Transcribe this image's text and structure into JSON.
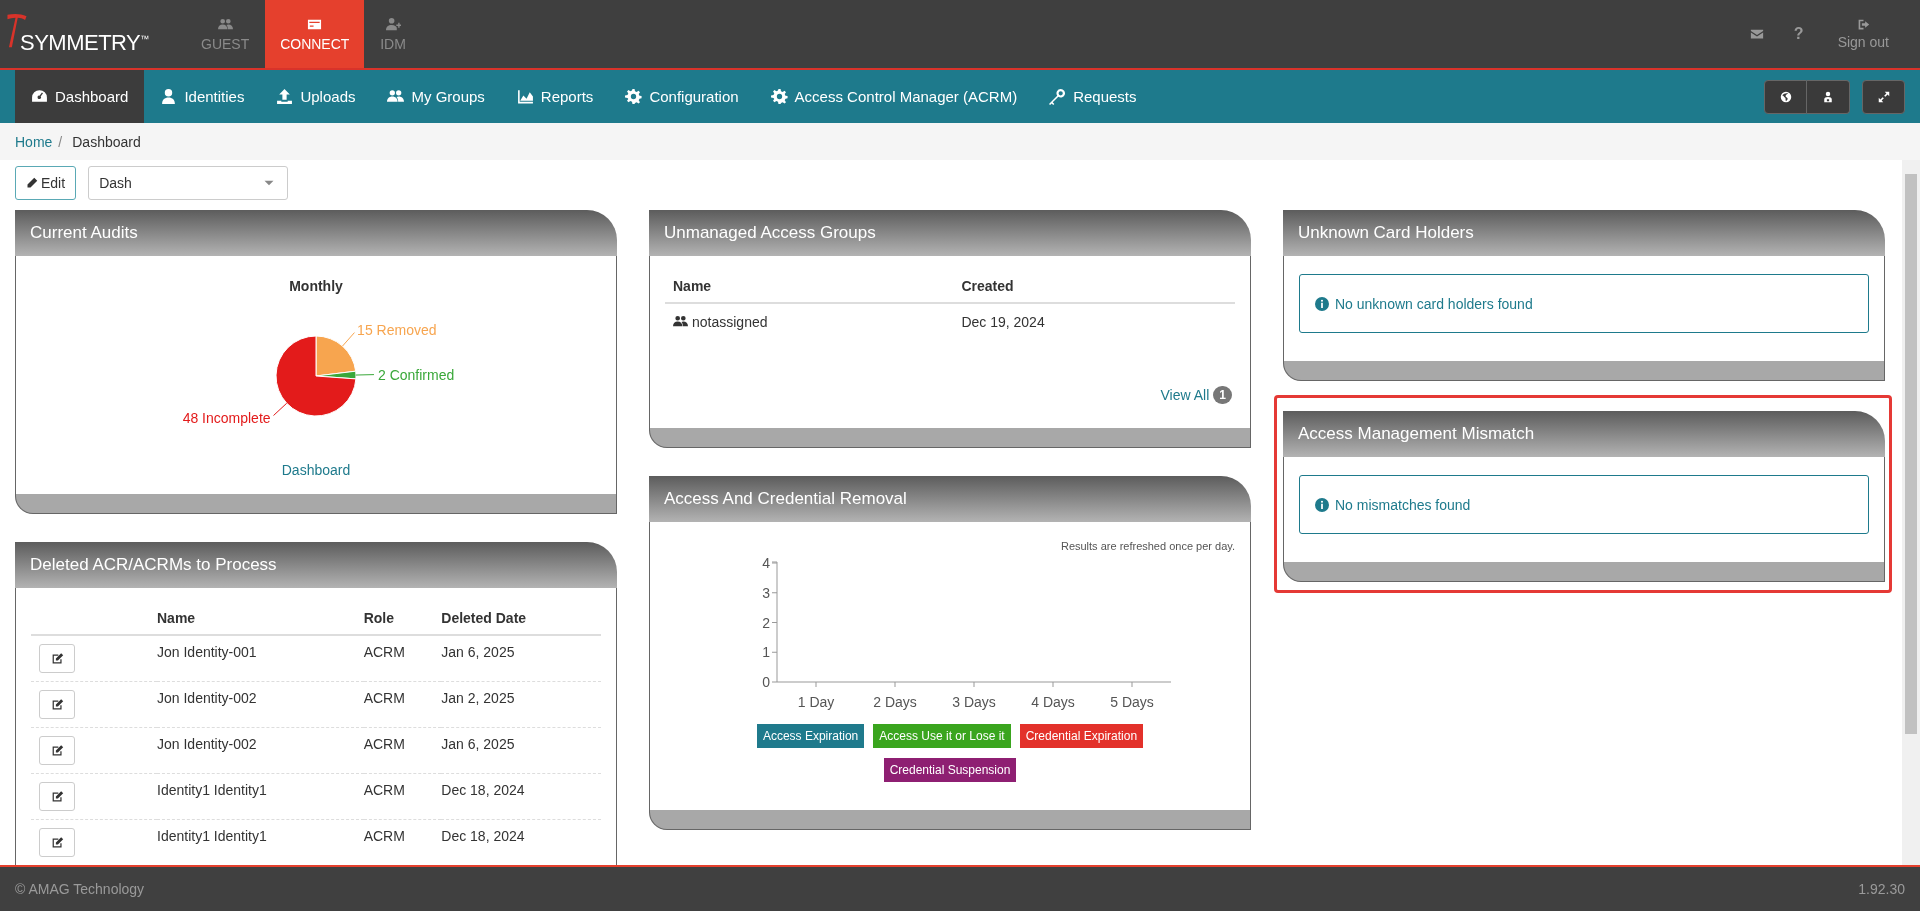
{
  "topbar": {
    "logo": {
      "text": "SYMMETRY",
      "mark": "™"
    },
    "apps": [
      {
        "label": "GUEST",
        "selected": false
      },
      {
        "label": "CONNECT",
        "selected": true
      },
      {
        "label": "IDM",
        "selected": false
      }
    ],
    "help": "?",
    "sign_out": "Sign out"
  },
  "nav": {
    "items": [
      {
        "label": "Dashboard",
        "selected": true
      },
      {
        "label": "Identities",
        "selected": false
      },
      {
        "label": "Uploads",
        "selected": false
      },
      {
        "label": "My Groups",
        "selected": false
      },
      {
        "label": "Reports",
        "selected": false
      },
      {
        "label": "Configuration",
        "selected": false
      },
      {
        "label": "Access Control Manager (ACRM)",
        "selected": false
      },
      {
        "label": "Requests",
        "selected": false
      }
    ]
  },
  "breadcrumb": {
    "items": [
      "Home",
      "Dashboard"
    ],
    "separator": "/"
  },
  "toolbar": {
    "edit": "Edit",
    "dashboard_select": {
      "value": "Dash"
    }
  },
  "columns": [
    {
      "panels": [
        {
          "kind": "pie",
          "title": "Current Audits",
          "highlighted": false,
          "link": "Dashboard",
          "chart_data": {
            "type": "pie",
            "title": "Monthly",
            "categories": [
              "15 Removed",
              "2 Confirmed",
              "48 Incomplete"
            ],
            "series": [
              {
                "values": [
                  15,
                  2,
                  48
                ],
                "colors": [
                  "#f7a54f",
                  "#3aa83a",
                  "#e31b1b"
                ]
              }
            ]
          }
        },
        {
          "kind": "table",
          "title": "Deleted ACR/ACRMs to Process",
          "highlighted": false,
          "columns": [
            "Name",
            "Role",
            "Deleted Date"
          ],
          "rows": [
            [
              "Jon Identity-001",
              "ACRM",
              "Jan 6, 2025"
            ],
            [
              "Jon Identity-002",
              "ACRM",
              "Jan 2, 2025"
            ],
            [
              "Jon Identity-002",
              "ACRM",
              "Jan 6, 2025"
            ],
            [
              "Identity1 Identity1",
              "ACRM",
              "Dec 18, 2024"
            ],
            [
              "Identity1 Identity1",
              "ACRM",
              "Dec 18, 2024"
            ]
          ]
        }
      ]
    },
    {
      "panels": [
        {
          "kind": "groups",
          "title": "Unmanaged Access Groups",
          "highlighted": false,
          "columns": [
            "Name",
            "Created"
          ],
          "rows": [
            [
              "notassigned",
              "Dec 19, 2024"
            ]
          ],
          "view_all": "View All",
          "count": "1"
        },
        {
          "kind": "bar",
          "title": "Access And Credential Removal",
          "highlighted": false,
          "note": "Results are refreshed once per day.",
          "chart_data": {
            "type": "bar",
            "categories": [
              "1 Day",
              "2 Days",
              "3 Days",
              "4 Days",
              "5 Days"
            ],
            "ylim": [
              0,
              4
            ],
            "yticks": [
              0,
              1,
              2,
              3,
              4
            ],
            "series": [
              {
                "name": "Access Expiration",
                "color": "#1f7a8c",
                "values": [
                  0,
                  0,
                  0,
                  0,
                  0
                ]
              },
              {
                "name": "Access Use it or Lose it",
                "color": "#3aa51e",
                "values": [
                  0,
                  0,
                  0,
                  0,
                  0
                ]
              },
              {
                "name": "Credential Expiration",
                "color": "#e3312a",
                "values": [
                  0,
                  0,
                  0,
                  0,
                  0
                ]
              },
              {
                "name": "Credential Suspension",
                "color": "#8e1f72",
                "values": [
                  0,
                  0,
                  0,
                  0,
                  0
                ]
              }
            ]
          }
        }
      ]
    },
    {
      "panels": [
        {
          "kind": "info",
          "title": "Unknown Card Holders",
          "highlighted": false,
          "message": "No unknown card holders found"
        },
        {
          "kind": "info",
          "title": "Access Management Mismatch",
          "highlighted": true,
          "message": "No mismatches found"
        }
      ]
    }
  ],
  "footer": {
    "copyright": "© AMAG Technology",
    "version": "1.92.30"
  }
}
